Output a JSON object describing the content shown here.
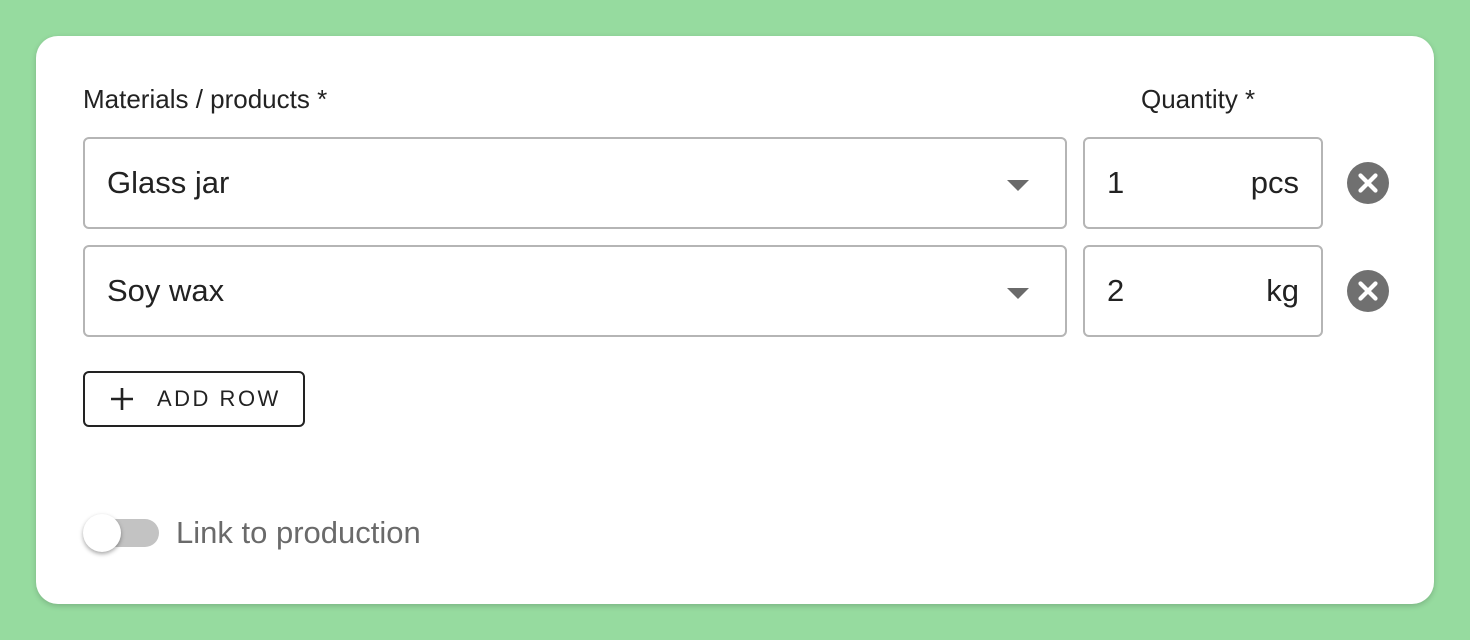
{
  "form": {
    "materials_label": "Materials / products *",
    "quantity_label": "Quantity *",
    "rows": [
      {
        "material": "Glass jar",
        "quantity": "1",
        "unit": "pcs"
      },
      {
        "material": "Soy wax",
        "quantity": "2",
        "unit": "kg"
      }
    ],
    "add_row_label": "ADD ROW",
    "toggle_label": "Link to production",
    "toggle_on": false
  },
  "colors": {
    "background": "#96db9f",
    "card": "#ffffff",
    "field_border": "#b5b5b5",
    "remove_icon": "#707070",
    "toggle_track": "#c3c3c3"
  },
  "icons": {
    "dropdown": "caret-down-icon",
    "remove": "close-circle-icon",
    "add": "plus-icon"
  }
}
